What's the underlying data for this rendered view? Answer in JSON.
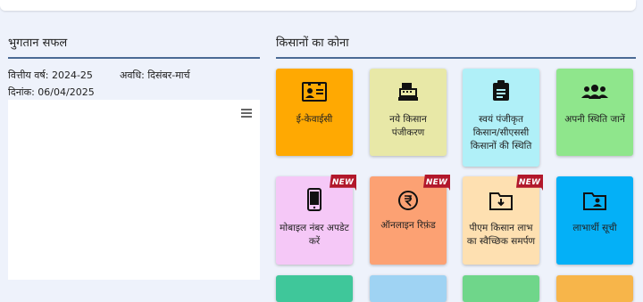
{
  "payment": {
    "title": "भुगतान सफल",
    "fy_label": "वित्तीय वर्ष: 2024-25",
    "period_label": "अवधि: दिसंबर-मार्च",
    "date_label": "दिनांक: 06/04/2025"
  },
  "farmers_corner": {
    "title": "किसानों का कोना",
    "badge_text": "NEW",
    "tiles": [
      {
        "label": "ई-केवाईसी",
        "icon": "id-card-icon",
        "color": "#ffa902"
      },
      {
        "label": "नये किसान पंजीकरण",
        "icon": "cash-register-icon",
        "color": "#e8e8a7"
      },
      {
        "label": "स्वयं पंजीकृत किसान/सीएससी किसानों की स्थिति",
        "icon": "clipboard-icon",
        "color": "#b0f0f8"
      },
      {
        "label": "अपनी स्थिति जानें",
        "icon": "users-icon",
        "color": "#8fe68c"
      },
      {
        "label": "मोबाइल नंबर अपडेट करें",
        "icon": "mobile-icon",
        "color": "#f5c8f7"
      },
      {
        "label": "ऑनलाइन रिफ़ंड",
        "icon": "rupee-refund-icon",
        "color": "#fca173"
      },
      {
        "label": "पीएम किसान लाभ का स्वैच्छिक समर्पण",
        "icon": "folder-download-icon",
        "color": "#fee0b1"
      },
      {
        "label": "लाभार्थी सूची",
        "icon": "folder-user-icon",
        "color": "#04b0f7"
      }
    ]
  }
}
